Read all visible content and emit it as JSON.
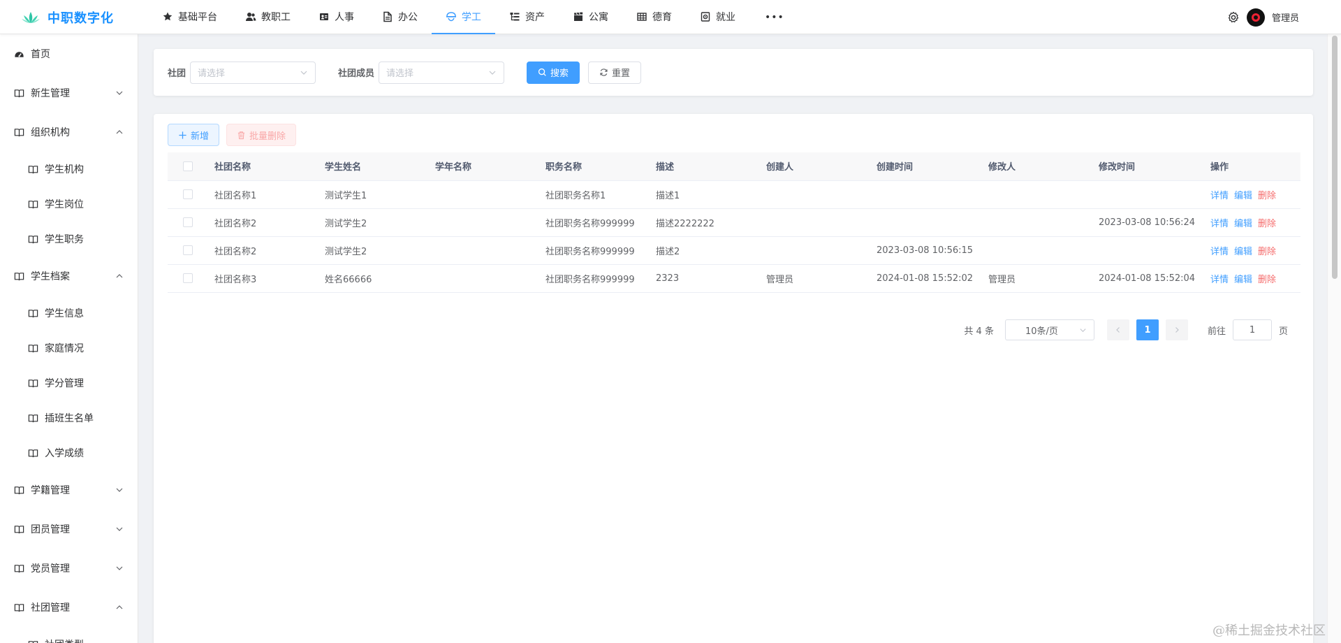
{
  "brand": {
    "title": "中职数字化"
  },
  "topnav": {
    "items": [
      {
        "label": "基础平台",
        "icon": "star-icon"
      },
      {
        "label": "教职工",
        "icon": "users-icon"
      },
      {
        "label": "人事",
        "icon": "id-card-icon"
      },
      {
        "label": "办公",
        "icon": "document-icon"
      },
      {
        "label": "学工",
        "icon": "student-icon",
        "active": true
      },
      {
        "label": "资产",
        "icon": "tree-icon"
      },
      {
        "label": "公寓",
        "icon": "clapper-icon"
      },
      {
        "label": "德育",
        "icon": "grid-icon"
      },
      {
        "label": "就业",
        "icon": "target-icon"
      }
    ],
    "more": "•••"
  },
  "user": {
    "name": "管理员"
  },
  "sidebar": {
    "home": "首页",
    "groups": [
      {
        "label": "新生管理",
        "expanded": false
      },
      {
        "label": "组织机构",
        "expanded": true,
        "children": [
          "学生机构",
          "学生岗位",
          "学生职务"
        ]
      },
      {
        "label": "学生档案",
        "expanded": true,
        "children": [
          "学生信息",
          "家庭情况",
          "学分管理",
          "插班生名单",
          "入学成绩"
        ]
      },
      {
        "label": "学籍管理",
        "expanded": false
      },
      {
        "label": "团员管理",
        "expanded": false
      },
      {
        "label": "党员管理",
        "expanded": false
      },
      {
        "label": "社团管理",
        "expanded": true,
        "children": [
          "社团类型"
        ]
      }
    ]
  },
  "search": {
    "club_label": "社团",
    "club_placeholder": "请选择",
    "member_label": "社团成员",
    "member_placeholder": "请选择",
    "search_button": "搜索",
    "reset_button": "重置"
  },
  "toolbar": {
    "add": "新增",
    "batch_delete": "批量删除"
  },
  "table": {
    "columns": [
      "社团名称",
      "学生姓名",
      "学年名称",
      "职务名称",
      "描述",
      "创建人",
      "创建时间",
      "修改人",
      "修改时间",
      "操作"
    ],
    "rows": [
      [
        "社团名称1",
        "测试学生1",
        "",
        "社团职务名称1",
        "描述1",
        "",
        "",
        "",
        ""
      ],
      [
        "社团名称2",
        "测试学生2",
        "",
        "社团职务名称999999",
        "描述2222222",
        "",
        "",
        "",
        "2023-03-08 10:56:24"
      ],
      [
        "社团名称2",
        "测试学生2",
        "",
        "社团职务名称999999",
        "描述2",
        "",
        "2023-03-08 10:56:15",
        "",
        ""
      ],
      [
        "社团名称3",
        "姓名66666",
        "",
        "社团职务名称999999",
        "2323",
        "管理员",
        "2024-01-08 15:52:02",
        "管理员",
        "2024-01-08 15:52:04"
      ]
    ],
    "actions": {
      "detail": "详情",
      "edit": "编辑",
      "delete": "删除"
    }
  },
  "pagination": {
    "total": "共 4 条",
    "page_size": "10条/页",
    "current_page": "1",
    "goto_label": "前往",
    "goto_value": "1",
    "page_suffix": "页"
  },
  "watermark": "@稀土掘金技术社区",
  "colors": {
    "primary": "#409eff",
    "danger": "#f56c6c",
    "brand": "#1890ff"
  }
}
